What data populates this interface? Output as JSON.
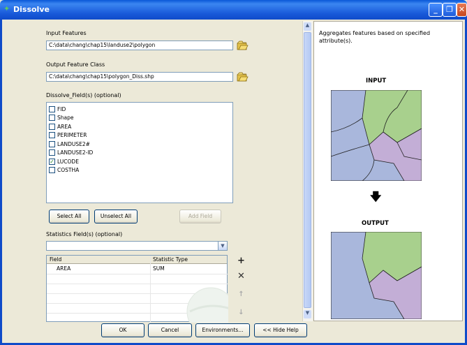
{
  "window": {
    "title": "Dissolve",
    "minimize": "_",
    "restore": "❐",
    "close": "✕"
  },
  "input_features": {
    "label": "Input Features",
    "value": "C:\\data\\chang\\chap15\\landuse2\\polygon"
  },
  "output_feature_class": {
    "label": "Output Feature Class",
    "value": "C:\\data\\chang\\chap15\\polygon_Diss.shp"
  },
  "dissolve_fields": {
    "label": "Dissolve_Field(s) (optional)",
    "items": [
      {
        "label": "FID",
        "checked": false
      },
      {
        "label": "Shape",
        "checked": false
      },
      {
        "label": "AREA",
        "checked": false
      },
      {
        "label": "PERIMETER",
        "checked": false
      },
      {
        "label": "LANDUSE2#",
        "checked": false
      },
      {
        "label": "LANDUSE2-ID",
        "checked": false
      },
      {
        "label": "LUCODE",
        "checked": true
      },
      {
        "label": "COSTHA",
        "checked": false
      }
    ]
  },
  "buttons": {
    "select_all": "Select All",
    "unselect_all": "Unselect All",
    "add_field": "Add Field",
    "ok": "OK",
    "cancel": "Cancel",
    "environments": "Environments...",
    "hide_help": "<< Hide Help"
  },
  "statistics": {
    "label": "Statistics Field(s) (optional)",
    "combo_value": "",
    "columns": [
      "Field",
      "Statistic Type"
    ],
    "rows": [
      {
        "field": "AREA",
        "type": "SUM"
      }
    ],
    "side_buttons": [
      "+",
      "✕",
      "↑",
      "↓"
    ]
  },
  "help": {
    "description": "Aggregates features based on specified attribute(s).",
    "input_label": "INPUT",
    "output_label": "OUTPUT",
    "arrow": "🡇"
  },
  "colors": {
    "green": "#a8d08d",
    "blue": "#a9b7dc",
    "purple": "#c3aed6",
    "titlebar": "#0f4bc9"
  }
}
